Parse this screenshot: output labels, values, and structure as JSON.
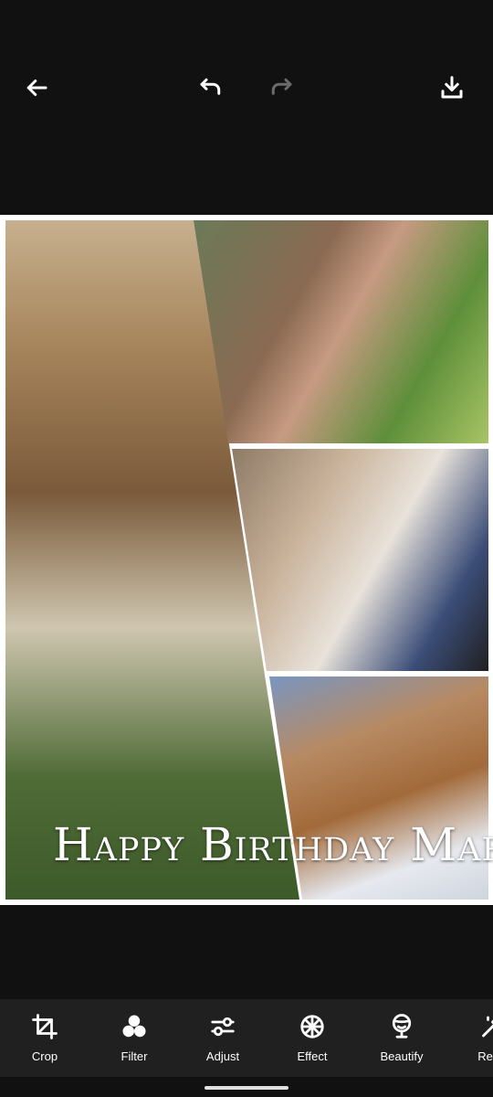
{
  "top_bar": {
    "back_icon": "arrow-left-icon",
    "undo_icon": "undo-icon",
    "redo_icon": "redo-icon",
    "download_icon": "download-icon"
  },
  "collage": {
    "greeting": "Happy Birthday Mary!",
    "photos": [
      "masked-woman-photo",
      "selfie-with-creature-photo",
      "woman-holding-lamb-photo",
      "woman-in-snow-photo"
    ]
  },
  "toolbar": {
    "items": [
      {
        "label": "Crop",
        "icon": "crop-icon"
      },
      {
        "label": "Filter",
        "icon": "filter-icon"
      },
      {
        "label": "Adjust",
        "icon": "adjust-icon"
      },
      {
        "label": "Effect",
        "icon": "effect-icon"
      },
      {
        "label": "Beautify",
        "icon": "beautify-icon"
      },
      {
        "label": "Rem",
        "icon": "remove-icon"
      }
    ]
  },
  "colors": {
    "background": "#111111",
    "toolbar_bg": "#202020",
    "disabled_icon": "#6b6b6b",
    "canvas_frame": "#ffffff"
  }
}
